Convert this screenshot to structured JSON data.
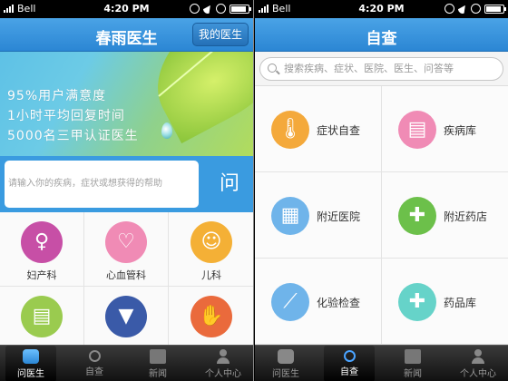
{
  "status": {
    "carrier": "Bell",
    "time": "4:20 PM"
  },
  "left": {
    "title": "春雨医生",
    "my_doctor_button": "我的医生",
    "banner": {
      "line1": "95%用户满意度",
      "line2": "1小时平均回复时间",
      "line3": "5000名三甲认证医生"
    },
    "ask": {
      "placeholder": "请输入你的疾病，症状或想获得的帮助",
      "button": "问"
    },
    "departments": [
      {
        "label": "妇产科",
        "icon": "pregnancy-icon",
        "color": "#c74fa6"
      },
      {
        "label": "心血管科",
        "icon": "heart-icon",
        "color": "#f08bb5"
      },
      {
        "label": "儿科",
        "icon": "baby-icon",
        "color": "#f4b036"
      },
      {
        "label": "",
        "icon": "document-icon",
        "color": "#9acb4f"
      },
      {
        "label": "",
        "icon": "suit-icon",
        "color": "#3a5aa8"
      },
      {
        "label": "",
        "icon": "hand-icon",
        "color": "#ea6a3c"
      }
    ]
  },
  "right": {
    "title": "自查",
    "search_placeholder": "搜索疾病、症状、医院、医生、问答等",
    "items": [
      {
        "label": "症状自查",
        "icon": "thermometer-icon",
        "color": "#f4a93b"
      },
      {
        "label": "疾病库",
        "icon": "medical-record-icon",
        "color": "#f08bb5"
      },
      {
        "label": "附近医院",
        "icon": "hospital-icon",
        "color": "#6fb4ea"
      },
      {
        "label": "附近药店",
        "icon": "pharmacy-icon",
        "color": "#6cc04a"
      },
      {
        "label": "化验检查",
        "icon": "test-tube-icon",
        "color": "#6fb4ea"
      },
      {
        "label": "药品库",
        "icon": "medicine-kit-icon",
        "color": "#66d3c9"
      }
    ]
  },
  "tabs": [
    {
      "label": "问医生",
      "icon": "chat-icon"
    },
    {
      "label": "自查",
      "icon": "search-icon"
    },
    {
      "label": "新闻",
      "icon": "news-icon"
    },
    {
      "label": "个人中心",
      "icon": "user-icon"
    }
  ]
}
